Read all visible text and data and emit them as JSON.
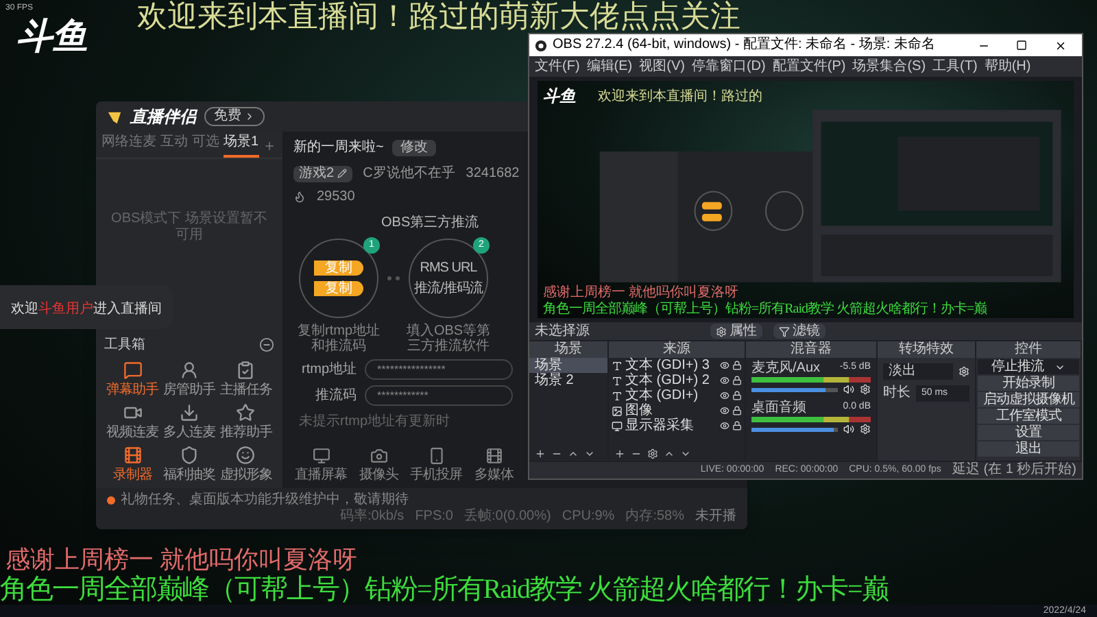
{
  "overlay": {
    "fps": "30 FPS",
    "logo": "斗鱼",
    "marquee": "欢迎来到本直播间！路过的萌新大佬点点关注",
    "thanks_line": "感谢上周榜一 就他吗你叫夏洛呀",
    "promo_line": "角色一周全部巅峰（可帮上号）钻粉=所有Raid教学 火箭超火啥都行！办卡=巅"
  },
  "join_toast": {
    "prefix": "欢迎",
    "user": "斗鱼用户",
    "suffix": "进入直播间"
  },
  "companion": {
    "app_name": "直播伴侣",
    "badge": "免费",
    "tabs": [
      {
        "label": "网络连麦",
        "selected": false
      },
      {
        "label": "互动",
        "selected": false
      },
      {
        "label": "可选",
        "selected": false
      },
      {
        "label": "场景1",
        "selected": true
      }
    ],
    "scene_notice": "OBS模式下 场景设置暂不可用",
    "toolbox_title": "工具箱",
    "tools": [
      {
        "label": "弹幕助手",
        "active": true
      },
      {
        "label": "房管助手",
        "active": false
      },
      {
        "label": "主播任务",
        "active": false
      },
      {
        "label": "视频连麦",
        "active": false
      },
      {
        "label": "多人连麦",
        "active": false
      },
      {
        "label": "推荐助手",
        "active": false
      },
      {
        "label": "录制器",
        "active": true
      },
      {
        "label": "福利抽奖",
        "active": false
      },
      {
        "label": "虚拟形象",
        "active": false
      }
    ],
    "room": {
      "title": "新的一周来啦~",
      "edit": "修改",
      "category": "游戏2",
      "tagline": "C罗说他不在乎",
      "room_id": "3241682",
      "heat": "29530"
    },
    "section_title": "OBS第三方推流",
    "steps": [
      {
        "number": "1",
        "kind": "buttons",
        "items": [
          "复制",
          "复制"
        ],
        "caption": "复制rtmp地址和推流码"
      },
      {
        "number": "2",
        "kind": "labels",
        "items": [
          "RMS URL",
          "推流/推码流"
        ],
        "caption": "填入OBS等第三方推流软件"
      }
    ],
    "fields": [
      {
        "label": "rtmp地址",
        "value": "****************"
      },
      {
        "label": "推流码",
        "value": "************"
      }
    ],
    "hint": "未提示rtmp地址有更新时",
    "sources": [
      "直播屏幕",
      "摄像头",
      "手机投屏",
      "多媒体"
    ],
    "status": {
      "notice": "礼物任务、桌面版本功能升级维护中，敬请期待",
      "stats": [
        "码率:0kb/s",
        "FPS:0",
        "丢帧:0(0.00%)",
        "CPU:9%",
        "内存:58%"
      ],
      "live_state": "未开播"
    }
  },
  "obs": {
    "title": "OBS 27.2.4 (64-bit, windows) - 配置文件: 未命名 - 场景: 未命名",
    "menu": [
      "文件(F)",
      "编辑(E)",
      "视图(V)",
      "停靠窗口(D)",
      "配置文件(P)",
      "场景集合(S)",
      "工具(T)",
      "帮助(H)"
    ],
    "preview": {
      "logo": "斗鱼",
      "marquee": "欢迎来到本直播间！路过的",
      "thanks_line": "感谢上周榜一 就他吗你叫夏洛呀",
      "promo_line": "角色一周全部巅峰（可帮上号）钻粉=所有Raid教学 火箭超火啥都行！办卡=巅"
    },
    "no_source": "未选择源",
    "properties": "属性",
    "filters": "滤镜",
    "docks": [
      "场景",
      "来源",
      "混音器",
      "转场特效",
      "控件"
    ],
    "scenes": [
      {
        "label": "场景",
        "selected": true
      },
      {
        "label": "场景 2",
        "selected": false
      }
    ],
    "sources": [
      {
        "label": "文本 (GDI+) 3",
        "kind": "text"
      },
      {
        "label": "文本 (GDI+) 2",
        "kind": "text"
      },
      {
        "label": "文本 (GDI+)",
        "kind": "text"
      },
      {
        "label": "图像",
        "kind": "image"
      },
      {
        "label": "显示器采集",
        "kind": "display"
      }
    ],
    "mixer": [
      {
        "name": "麦克风/Aux",
        "reading": "-5.5 dB",
        "level": 0.85
      },
      {
        "name": "桌面音频",
        "reading": "0.0 dB",
        "level": 0.95
      }
    ],
    "transition": {
      "type": "淡出",
      "duration_label": "时长",
      "duration": "50 ms"
    },
    "controls": [
      {
        "label": "停止推流",
        "kind": "dropdown"
      },
      {
        "label": "开始录制",
        "kind": "button"
      },
      {
        "label": "启动虚拟摄像机",
        "kind": "button"
      },
      {
        "label": "工作室模式",
        "kind": "button"
      },
      {
        "label": "设置",
        "kind": "button"
      },
      {
        "label": "退出",
        "kind": "button"
      }
    ],
    "status": {
      "live": "LIVE: 00:00:00",
      "rec": "REC: 00:00:00",
      "cpu": "CPU: 0.5%, 60.00 fps",
      "delay": "延迟 (在 1 秒后开始)"
    }
  },
  "taskbar": {
    "date": "2022/4/24"
  }
}
